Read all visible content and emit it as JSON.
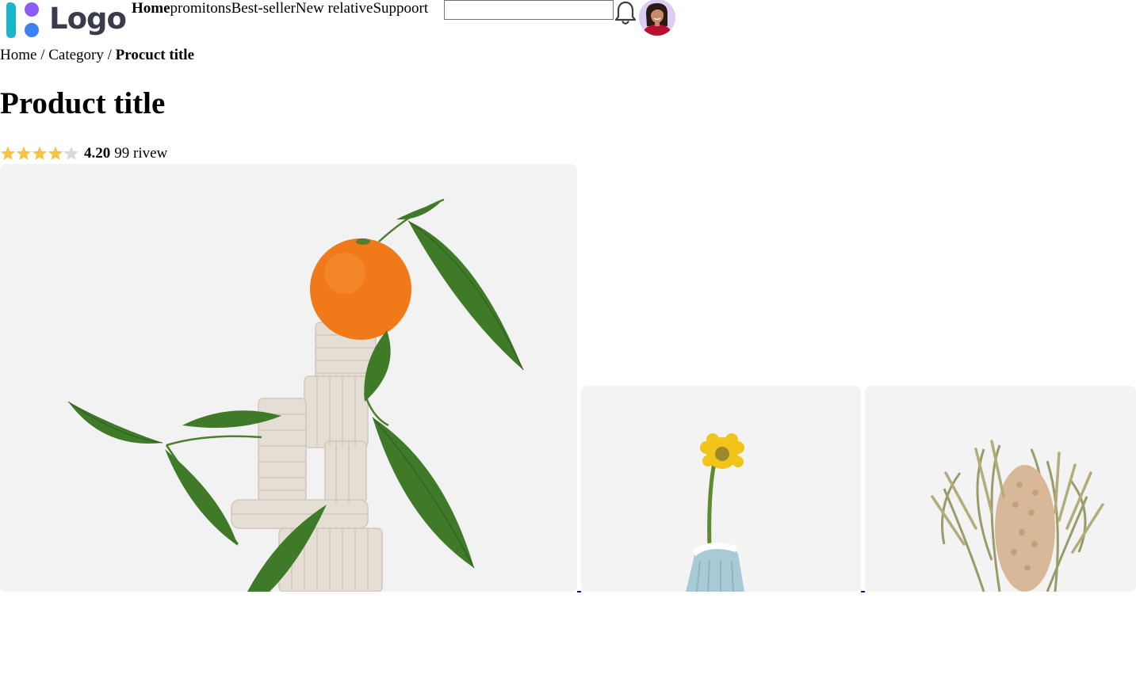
{
  "header": {
    "logo_text": "Logo",
    "logo_colors": {
      "teal": "#1bb5c9",
      "purple": "#8b5cf6",
      "blue": "#3b82f6",
      "text": "#3a3d49"
    },
    "nav": [
      {
        "label": "Home",
        "active": true
      },
      {
        "label": "promitons",
        "active": false
      },
      {
        "label": "Best-seller",
        "active": false
      },
      {
        "label": "New relative",
        "active": false
      },
      {
        "label": "Suppoort",
        "active": false
      }
    ],
    "search": {
      "value": "",
      "placeholder": ""
    },
    "bell_icon": "bell-icon",
    "avatar_icon": "user-avatar"
  },
  "breadcrumb": {
    "items": [
      "Home",
      "Category"
    ],
    "separator": "/",
    "current": "Procuct title"
  },
  "product": {
    "title": "Product title",
    "rating": {
      "value": "4.20",
      "count_text": "99 rivew",
      "stars_filled": 4.2,
      "stars_total": 5,
      "star_color": "#f5c542",
      "star_empty_color": "#d9d9d9"
    }
  },
  "gallery": {
    "main_image": "orange-on-clay-sculpture",
    "thumbnails": [
      "yellow-flower-in-blue-vase",
      "dried-banksia-flower"
    ]
  }
}
